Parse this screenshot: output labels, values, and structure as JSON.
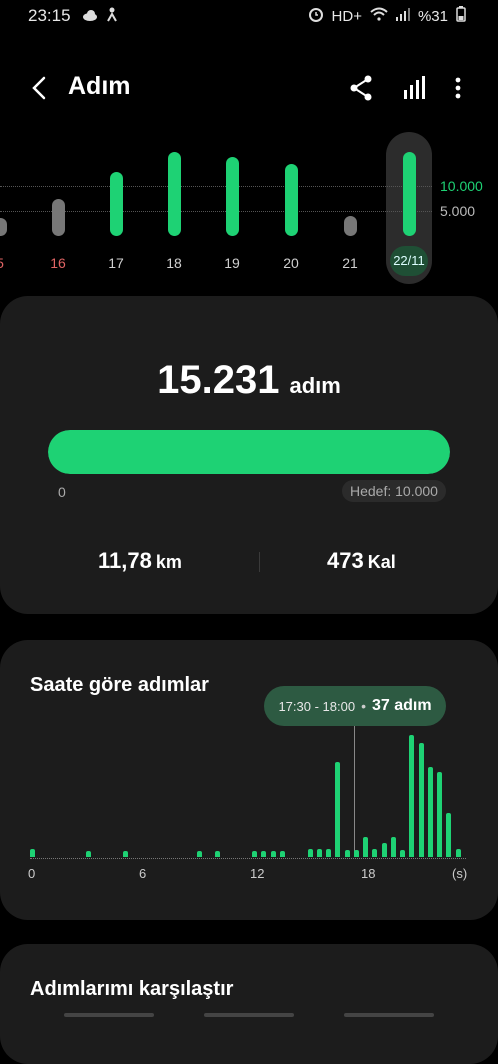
{
  "status_bar": {
    "time": "23:15",
    "network": "HD+",
    "battery": "%31"
  },
  "header": {
    "title": "Adım"
  },
  "week": {
    "days": [
      {
        "label": "5",
        "value": 2000,
        "low": true,
        "red": true
      },
      {
        "label": "16",
        "value": 4500,
        "low": true,
        "red": true
      },
      {
        "label": "17",
        "value": 7800,
        "low": false,
        "red": false
      },
      {
        "label": "18",
        "value": 10200,
        "low": false,
        "red": false
      },
      {
        "label": "19",
        "value": 9600,
        "low": false,
        "red": false
      },
      {
        "label": "20",
        "value": 8700,
        "low": false,
        "red": false
      },
      {
        "label": "21",
        "value": 2400,
        "low": true,
        "red": false
      },
      {
        "label": "22/11",
        "value": 15231,
        "low": false,
        "red": false,
        "selected": true
      }
    ],
    "ref_high": "10.000",
    "ref_low": "5.000"
  },
  "summary": {
    "steps": "15.231",
    "unit": "adım",
    "progress_fraction": 1.0,
    "zero_label": "0",
    "goal_label": "Hedef: 10.000",
    "distance_value": "11,78",
    "distance_unit": "km",
    "calories_value": "473",
    "calories_unit": "Kal"
  },
  "hourly": {
    "title": "Saate göre adımlar",
    "tooltip_range": "17:30 - 18:00",
    "tooltip_steps": "37 adım",
    "axis_labels": [
      "0",
      "6",
      "12",
      "18",
      "(s)"
    ],
    "chart_data": {
      "type": "bar",
      "x_unit": "hours",
      "bars": [
        {
          "x": 0,
          "v": 8
        },
        {
          "x": 3,
          "v": 6
        },
        {
          "x": 5,
          "v": 6
        },
        {
          "x": 9,
          "v": 6
        },
        {
          "x": 10,
          "v": 6
        },
        {
          "x": 12,
          "v": 6
        },
        {
          "x": 12.5,
          "v": 6
        },
        {
          "x": 13,
          "v": 6
        },
        {
          "x": 13.5,
          "v": 6
        },
        {
          "x": 15,
          "v": 8
        },
        {
          "x": 15.5,
          "v": 8
        },
        {
          "x": 16,
          "v": 8
        },
        {
          "x": 16.5,
          "v": 95
        },
        {
          "x": 17,
          "v": 7
        },
        {
          "x": 17.5,
          "v": 7
        },
        {
          "x": 18,
          "v": 20
        },
        {
          "x": 18.5,
          "v": 8
        },
        {
          "x": 19,
          "v": 14
        },
        {
          "x": 19.5,
          "v": 20
        },
        {
          "x": 20,
          "v": 7
        },
        {
          "x": 20.5,
          "v": 122
        },
        {
          "x": 21,
          "v": 114
        },
        {
          "x": 21.5,
          "v": 90
        },
        {
          "x": 22,
          "v": 85
        },
        {
          "x": 22.5,
          "v": 44
        },
        {
          "x": 23,
          "v": 8
        }
      ]
    }
  },
  "compare": {
    "title": "Adımlarımı karşılaştır"
  }
}
